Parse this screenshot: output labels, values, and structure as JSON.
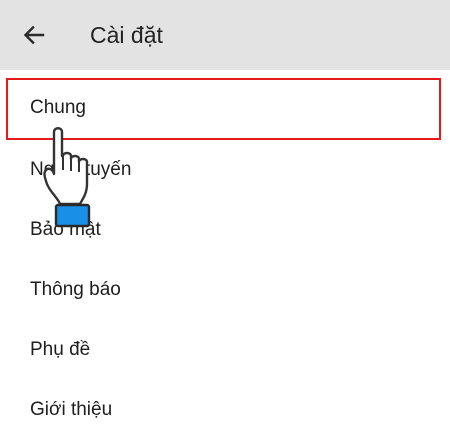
{
  "app_bar": {
    "back_icon": "arrow-left-icon",
    "title": "Cài đặt"
  },
  "settings": {
    "items": [
      {
        "label": "Chung"
      },
      {
        "label": "Ngoại tuyến"
      },
      {
        "label": "Bảo mật"
      },
      {
        "label": "Thông báo"
      },
      {
        "label": "Phụ đề"
      },
      {
        "label": "Giới thiệu"
      }
    ]
  },
  "overlay": {
    "pointer_icon": "hand-pointer-icon",
    "highlight_color": "#e31b1b",
    "cuff_color": "#1a8fe8"
  }
}
